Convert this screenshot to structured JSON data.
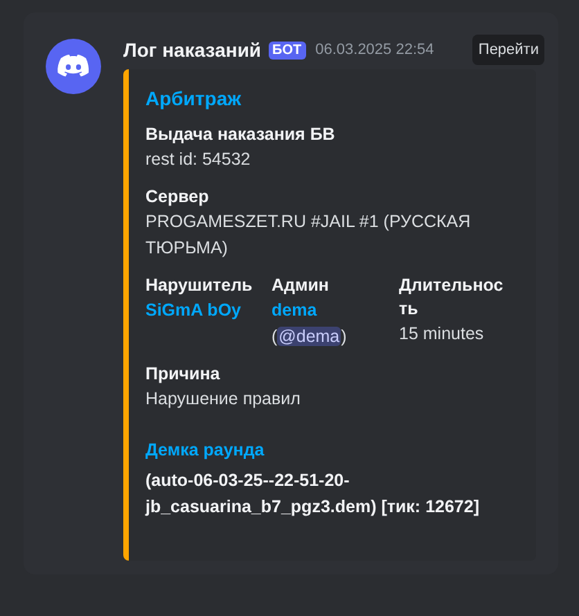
{
  "message": {
    "author": "Лог наказаний",
    "badge": "БОТ",
    "timestamp": "06.03.2025 22:54",
    "jump_button": "Перейти"
  },
  "embed": {
    "title": "Арбитраж",
    "fields": [
      {
        "name": "Выдача наказания БВ",
        "value": "rest id: 54532"
      },
      {
        "name": "Сервер",
        "value": "PROGAMESZET.RU #JAIL #1 (РУССКАЯ ТЮРЬМА)"
      }
    ],
    "inline_fields": [
      {
        "name": "Нарушитель",
        "value": "SiGmA bOy",
        "kind": "link"
      },
      {
        "name": "Админ",
        "value": "dema",
        "mention_open": "(",
        "mention": "@dema",
        "mention_close": ")",
        "kind": "link"
      },
      {
        "name": "Длительность",
        "value": "15 minutes",
        "kind": "text"
      }
    ],
    "reason": {
      "name": "Причина",
      "value": "Нарушение правил"
    },
    "demo": {
      "title": "Демка раунда",
      "value": "(auto-06-03-25--22-51-20-jb_casuarina_b7_pgz3.dem) [тик: 12672]"
    }
  }
}
